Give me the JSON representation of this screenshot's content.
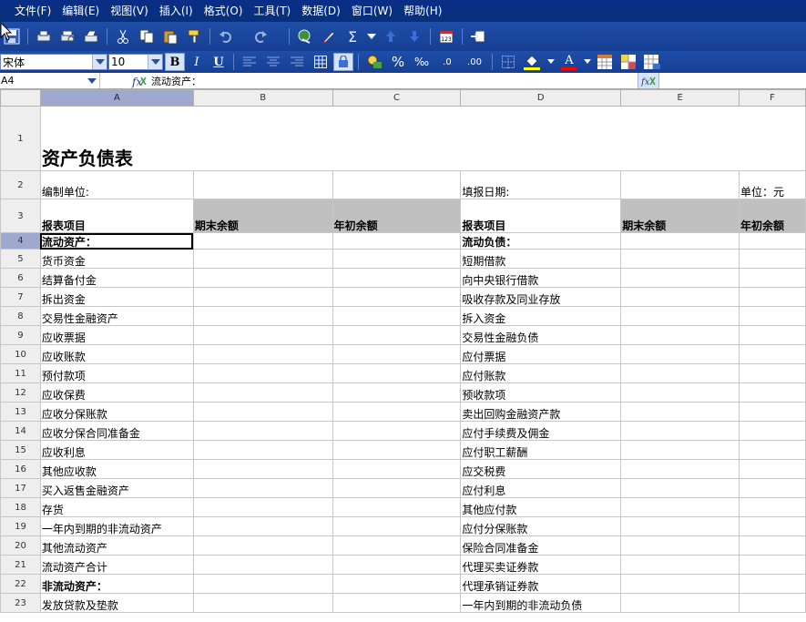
{
  "menu": [
    "文件(F)",
    "编辑(E)",
    "视图(V)",
    "插入(I)",
    "格式(O)",
    "工具(T)",
    "数据(D)",
    "窗口(W)",
    "帮助(H)"
  ],
  "toolbar": {
    "icons": [
      "save-icon",
      "print-icon",
      "print-preview-icon",
      "print-setup-icon",
      "cut-icon",
      "copy-icon",
      "paste-icon",
      "format-painter-icon",
      "undo-icon",
      "redo-icon",
      "hyperlink-icon",
      "pen-icon",
      "autosum-icon",
      "dropdown-icon",
      "sort-asc-icon",
      "sort-desc-icon",
      "calendar-icon",
      "export-icon"
    ],
    "sum_label": "Σ"
  },
  "format": {
    "font_name": "宋体",
    "font_size": "10",
    "bold_label": "B",
    "italic_label": "I",
    "underline_label": "U",
    "percent_label": "%",
    "permille_label": "‰",
    "dec_add_label": ".0",
    "dec_sub_label": ".00",
    "font_color_label": "A",
    "colors": {
      "fill": "#ffff00",
      "font": "#ff0000"
    }
  },
  "formula_bar": {
    "name_box": "A4",
    "content": "流动资产："
  },
  "columns": [
    "A",
    "B",
    "C",
    "D",
    "E",
    "F"
  ],
  "selected_column": "A",
  "selected_row": "4",
  "sheet": {
    "title": "资产负债表",
    "row2": {
      "a": "编制单位:",
      "d": "填报日期:",
      "f": "单位：元"
    },
    "headers": [
      "报表项目",
      "期末余额",
      "年初余额",
      "报表项目",
      "期末余额",
      "年初余额"
    ],
    "rows": [
      {
        "num": "4",
        "left": "流动资产：",
        "right": "流动负债：",
        "bold": true
      },
      {
        "num": "5",
        "left": "货币资金",
        "right": "短期借款"
      },
      {
        "num": "6",
        "left": "结算备付金",
        "right": "向中央银行借款"
      },
      {
        "num": "7",
        "left": "拆出资金",
        "right": "吸收存款及同业存放"
      },
      {
        "num": "8",
        "left": "交易性金融资产",
        "right": "拆入资金"
      },
      {
        "num": "9",
        "left": "应收票据",
        "right": "交易性金融负债"
      },
      {
        "num": "10",
        "left": "应收账款",
        "right": "应付票据"
      },
      {
        "num": "11",
        "left": "预付款项",
        "right": "应付账款"
      },
      {
        "num": "12",
        "left": "应收保费",
        "right": "预收款项"
      },
      {
        "num": "13",
        "left": "应收分保账款",
        "right": "卖出回购金融资产款"
      },
      {
        "num": "14",
        "left": "应收分保合同准备金",
        "right": "应付手续费及佣金"
      },
      {
        "num": "15",
        "left": "应收利息",
        "right": "应付职工薪酬"
      },
      {
        "num": "16",
        "left": "其他应收款",
        "right": "应交税费"
      },
      {
        "num": "17",
        "left": "买入返售金融资产",
        "right": "应付利息"
      },
      {
        "num": "18",
        "left": "存货",
        "right": "其他应付款"
      },
      {
        "num": "19",
        "left": "一年内到期的非流动资产",
        "right": "应付分保账款"
      },
      {
        "num": "20",
        "left": "其他流动资产",
        "right": "保险合同准备金"
      },
      {
        "num": "21",
        "left": "流动资产合计",
        "right": "代理买卖证券款"
      },
      {
        "num": "22",
        "left": "非流动资产：",
        "right": "代理承销证券款",
        "left_bold": true
      },
      {
        "num": "23",
        "left": "发放贷款及垫款",
        "right": "一年内到期的非流动负债"
      }
    ]
  }
}
